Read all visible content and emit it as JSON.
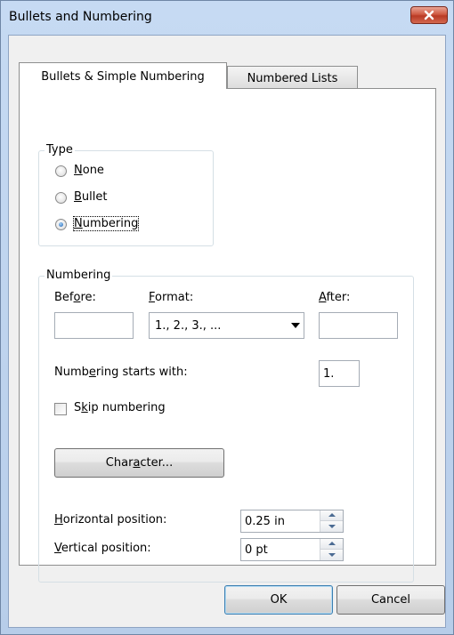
{
  "window": {
    "title": "Bullets and Numbering"
  },
  "tabs": [
    {
      "label": "Bullets & Simple Numbering",
      "active": true
    },
    {
      "label": "Numbered Lists",
      "active": false
    }
  ],
  "type_group": {
    "title": "Type",
    "options": [
      {
        "pre": "",
        "key": "N",
        "post": "one",
        "checked": false
      },
      {
        "pre": "",
        "key": "B",
        "post": "ullet",
        "checked": false
      },
      {
        "pre": "",
        "key": "N",
        "post": "umbering",
        "checked": true
      }
    ]
  },
  "numbering_group": {
    "title": "Numbering",
    "before": {
      "pre": "Bef",
      "key": "o",
      "post": "re:",
      "value": ""
    },
    "format": {
      "pre": "",
      "key": "F",
      "post": "ormat:",
      "value": "1., 2., 3., ..."
    },
    "after": {
      "pre": "",
      "key": "A",
      "post": "fter:",
      "value": ""
    },
    "starts_with": {
      "pre": "Numb",
      "key": "e",
      "post": "ring starts with:",
      "value": "1."
    },
    "skip_numbering": {
      "pre": "S",
      "key": "k",
      "post": "ip numbering",
      "checked": false
    },
    "character_button": {
      "pre": "Char",
      "key": "a",
      "post": "cter..."
    },
    "horizontal_position": {
      "pre": "",
      "key": "H",
      "post": "orizontal position:",
      "value": "0.25 in"
    },
    "vertical_position": {
      "pre": "",
      "key": "V",
      "post": "ertical position:",
      "value": "0 pt"
    }
  },
  "footer": {
    "ok_label": "OK",
    "cancel_label": "Cancel"
  }
}
